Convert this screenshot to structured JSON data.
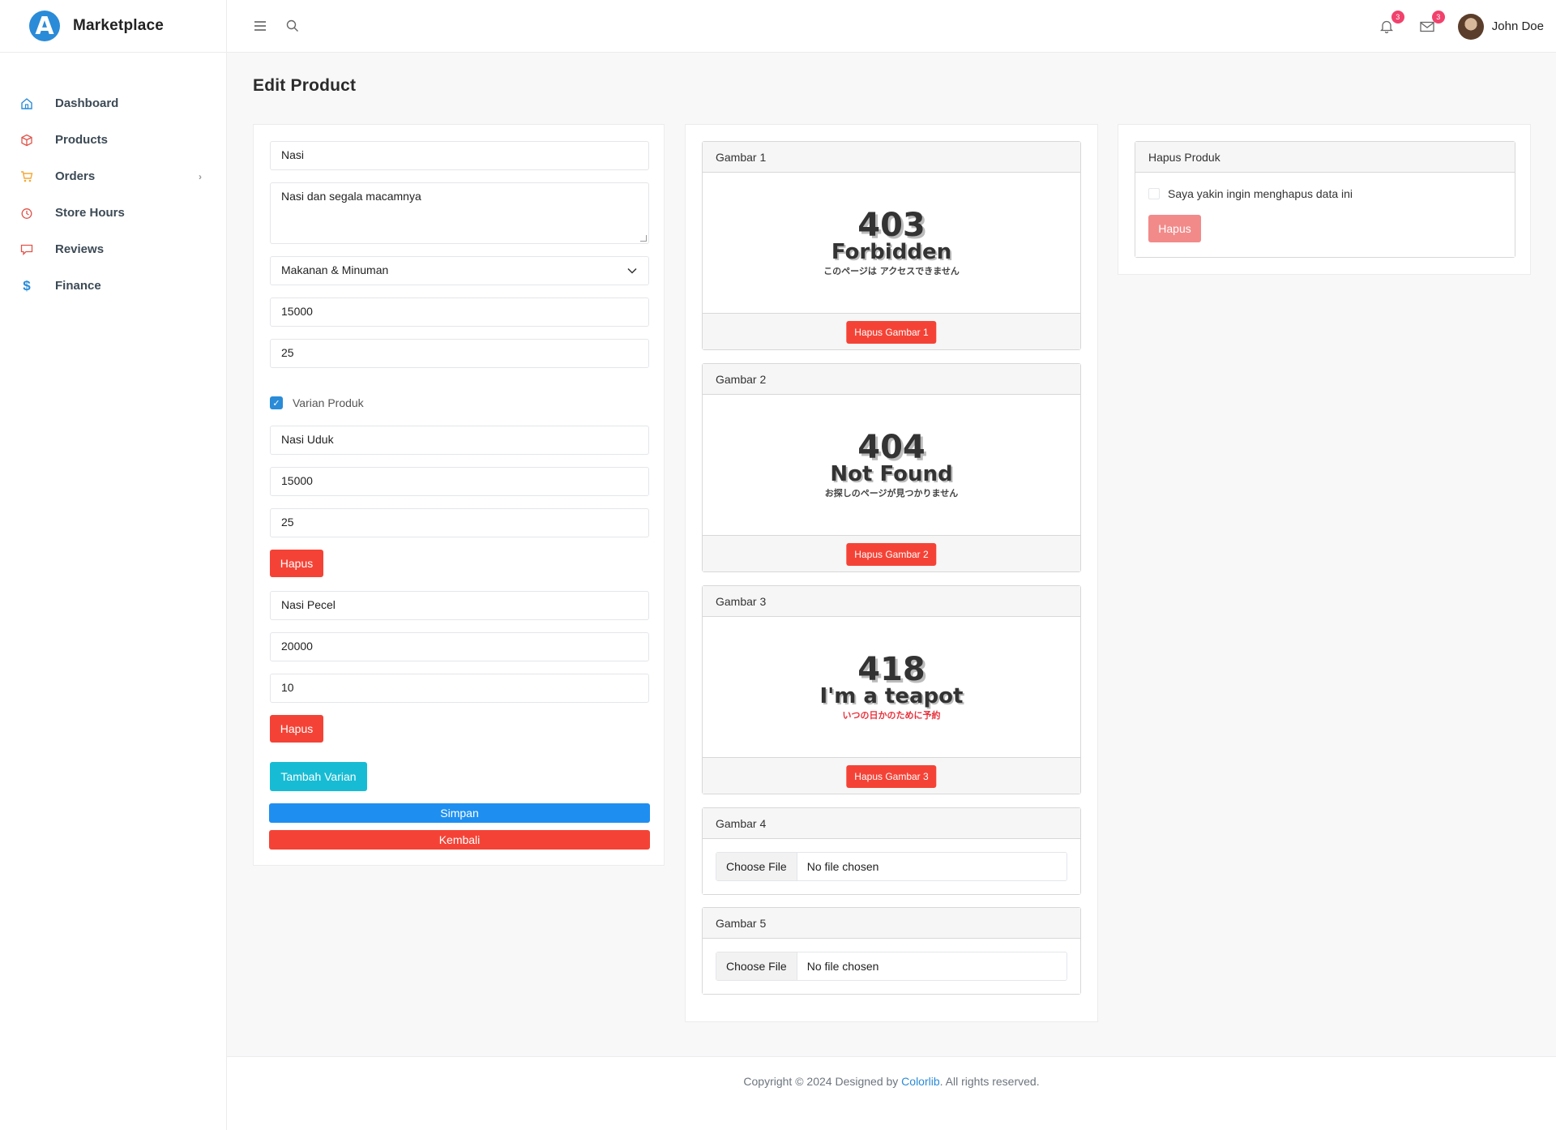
{
  "brand": {
    "name": "Marketplace",
    "logo_letter": "A"
  },
  "sidebar": {
    "items": [
      {
        "label": "Dashboard",
        "icon": "home-icon"
      },
      {
        "label": "Products",
        "icon": "box-icon"
      },
      {
        "label": "Orders",
        "icon": "cart-icon"
      },
      {
        "label": "Store Hours",
        "icon": "clock-icon"
      },
      {
        "label": "Reviews",
        "icon": "chat-icon"
      },
      {
        "label": "Finance",
        "icon": "dollar-icon"
      }
    ]
  },
  "topbar": {
    "notifications_count": "3",
    "messages_count": "3",
    "user_name": "John Doe"
  },
  "page": {
    "title": "Edit Product"
  },
  "form": {
    "name": "Nasi",
    "description": "Nasi dan segala macamnya",
    "category": "Makanan & Minuman",
    "price": "15000",
    "stock": "25",
    "variant_checkbox_label": "Varian Produk",
    "variants": [
      {
        "name": "Nasi Uduk",
        "price": "15000",
        "stock": "25",
        "delete_label": "Hapus"
      },
      {
        "name": "Nasi Pecel",
        "price": "20000",
        "stock": "10",
        "delete_label": "Hapus"
      }
    ],
    "add_variant_label": "Tambah Varian",
    "save_label": "Simpan",
    "back_label": "Kembali"
  },
  "images": {
    "panels": [
      {
        "title": "Gambar 1",
        "delete_label": "Hapus Gambar 1",
        "art": {
          "code": "403",
          "word": "Forbidden",
          "sub": "このページは アクセスできません"
        }
      },
      {
        "title": "Gambar 2",
        "delete_label": "Hapus Gambar 2",
        "art": {
          "code": "404",
          "word": "Not Found",
          "sub": "お探しのページが見つかりません"
        }
      },
      {
        "title": "Gambar 3",
        "delete_label": "Hapus Gambar 3",
        "art": {
          "code": "418",
          "word": "I'm a teapot",
          "sub": "いつの日かのために予約"
        }
      },
      {
        "title": "Gambar 4",
        "choose_label": "Choose File",
        "file_label": "No file chosen"
      },
      {
        "title": "Gambar 5",
        "choose_label": "Choose File",
        "file_label": "No file chosen"
      }
    ]
  },
  "delete_product": {
    "title": "Hapus Produk",
    "confirm_label": "Saya yakin ingin menghapus data ini",
    "button_label": "Hapus"
  },
  "footer": {
    "prefix": "Copyright © 2024 Designed by ",
    "link": "Colorlib",
    "suffix": ". All rights reserved."
  },
  "colors": {
    "primary": "#1e8ff0",
    "danger": "#f44336",
    "info": "#17bcd4",
    "badge": "#f1416c"
  }
}
